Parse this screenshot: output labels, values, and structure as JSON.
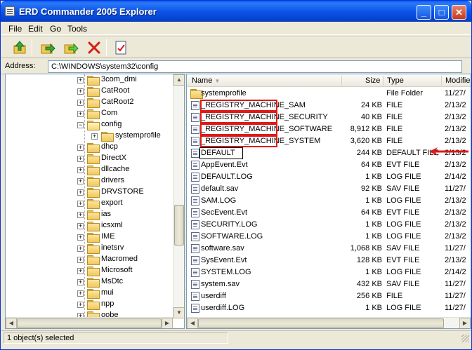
{
  "window": {
    "title": "ERD Commander 2005 Explorer"
  },
  "title_buttons": {
    "minimize": "_",
    "maximize": "□",
    "close": "✕"
  },
  "menu": [
    "File",
    "Edit",
    "Go",
    "Tools"
  ],
  "toolbar": [
    "up-folder-icon",
    "move-icon",
    "copy-icon",
    "delete-icon",
    "properties-icon"
  ],
  "address": {
    "label": "Address:",
    "value": "C:\\WINDOWS\\system32\\config"
  },
  "tree": [
    {
      "label": "3com_dmi",
      "depth": 0,
      "expander": "+",
      "open": false
    },
    {
      "label": "CatRoot",
      "depth": 0,
      "expander": "+",
      "open": false
    },
    {
      "label": "CatRoot2",
      "depth": 0,
      "expander": "+",
      "open": false
    },
    {
      "label": "Com",
      "depth": 0,
      "expander": "+",
      "open": false
    },
    {
      "label": "config",
      "depth": 0,
      "expander": "−",
      "open": true
    },
    {
      "label": "systemprofile",
      "depth": 1,
      "expander": "+",
      "open": false
    },
    {
      "label": "dhcp",
      "depth": 0,
      "expander": "+",
      "open": false
    },
    {
      "label": "DirectX",
      "depth": 0,
      "expander": "+",
      "open": false
    },
    {
      "label": "dllcache",
      "depth": 0,
      "expander": "+",
      "open": false
    },
    {
      "label": "drivers",
      "depth": 0,
      "expander": "+",
      "open": false
    },
    {
      "label": "DRVSTORE",
      "depth": 0,
      "expander": "+",
      "open": false
    },
    {
      "label": "export",
      "depth": 0,
      "expander": "+",
      "open": false
    },
    {
      "label": "ias",
      "depth": 0,
      "expander": "+",
      "open": false
    },
    {
      "label": "icsxml",
      "depth": 0,
      "expander": "+",
      "open": false
    },
    {
      "label": "IME",
      "depth": 0,
      "expander": "+",
      "open": false
    },
    {
      "label": "inetsrv",
      "depth": 0,
      "expander": "+",
      "open": false
    },
    {
      "label": "Macromed",
      "depth": 0,
      "expander": "+",
      "open": false
    },
    {
      "label": "Microsoft",
      "depth": 0,
      "expander": "+",
      "open": false
    },
    {
      "label": "MsDtc",
      "depth": 0,
      "expander": "+",
      "open": false
    },
    {
      "label": "mui",
      "depth": 0,
      "expander": "+",
      "open": false
    },
    {
      "label": "npp",
      "depth": 0,
      "expander": "+",
      "open": false
    },
    {
      "label": "oobe",
      "depth": 0,
      "expander": "+",
      "open": false
    }
  ],
  "columns": {
    "name": "Name",
    "size": "Size",
    "type": "Type",
    "modified": "Modifie"
  },
  "files": [
    {
      "name": "systemprofile",
      "size": "",
      "type": "File Folder",
      "modified": "11/27/",
      "is_folder": true
    },
    {
      "name": "_REGISTRY_MACHINE_SAM",
      "size": "24 KB",
      "type": "FILE",
      "modified": "2/13/2"
    },
    {
      "name": "_REGISTRY_MACHINE_SECURITY",
      "size": "40 KB",
      "type": "FILE",
      "modified": "2/13/2"
    },
    {
      "name": "_REGISTRY_MACHINE_SOFTWARE",
      "size": "8,912 KB",
      "type": "FILE",
      "modified": "2/13/2"
    },
    {
      "name": "_REGISTRY_MACHINE_SYSTEM",
      "size": "3,620 KB",
      "type": "FILE",
      "modified": "2/13/2"
    },
    {
      "name": "DEFAULT",
      "size": "244 KB",
      "type": "DEFAULT FILE",
      "modified": "2/13/2"
    },
    {
      "name": "AppEvent.Evt",
      "size": "64 KB",
      "type": "EVT FILE",
      "modified": "2/13/2"
    },
    {
      "name": "DEFAULT.LOG",
      "size": "1 KB",
      "type": "LOG FILE",
      "modified": "2/14/2"
    },
    {
      "name": "default.sav",
      "size": "92 KB",
      "type": "SAV FILE",
      "modified": "11/27/"
    },
    {
      "name": "SAM.LOG",
      "size": "1 KB",
      "type": "LOG FILE",
      "modified": "2/13/2"
    },
    {
      "name": "SecEvent.Evt",
      "size": "64 KB",
      "type": "EVT FILE",
      "modified": "2/13/2"
    },
    {
      "name": "SECURITY.LOG",
      "size": "1 KB",
      "type": "LOG FILE",
      "modified": "2/13/2"
    },
    {
      "name": "SOFTWARE.LOG",
      "size": "1 KB",
      "type": "LOG FILE",
      "modified": "2/13/2"
    },
    {
      "name": "software.sav",
      "size": "1,068 KB",
      "type": "SAV FILE",
      "modified": "11/27/"
    },
    {
      "name": "SysEvent.Evt",
      "size": "128 KB",
      "type": "EVT FILE",
      "modified": "2/13/2"
    },
    {
      "name": "SYSTEM.LOG",
      "size": "1 KB",
      "type": "LOG FILE",
      "modified": "2/14/2"
    },
    {
      "name": "system.sav",
      "size": "432 KB",
      "type": "SAV FILE",
      "modified": "11/27/"
    },
    {
      "name": "userdiff",
      "size": "256 KB",
      "type": "FILE",
      "modified": "11/27/"
    },
    {
      "name": "userdiff.LOG",
      "size": "1 KB",
      "type": "LOG FILE",
      "modified": "11/27/"
    }
  ],
  "status": "1 object(s) selected",
  "colors": {
    "titlebar": "#0a5cf3",
    "highlight_box": "#e01818",
    "arrow": "#e01818",
    "chrome": "#ece9d8"
  }
}
